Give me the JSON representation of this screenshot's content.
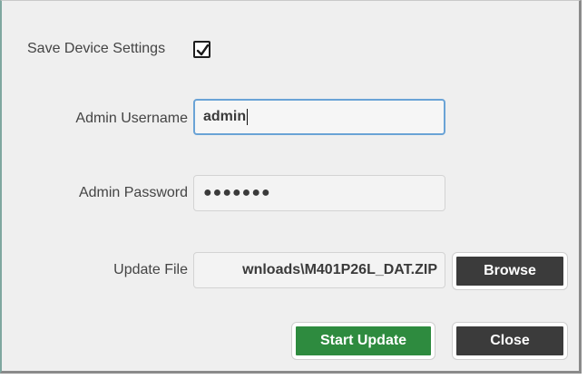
{
  "settings": {
    "save_label": "Save Device Settings",
    "save_checked": true
  },
  "username": {
    "label": "Admin Username",
    "value": "admin"
  },
  "password": {
    "label": "Admin Password",
    "value": "●●●●●●●"
  },
  "update_file": {
    "label": "Update File",
    "value": "wnloads\\M401P26L_DAT.ZIP"
  },
  "buttons": {
    "browse": "Browse",
    "start_update": "Start Update",
    "close": "Close"
  },
  "colors": {
    "start_button": "#2e8b3f",
    "dark_button": "#3b3b3b",
    "focus_border": "#6aa3d6"
  },
  "icons": {
    "checkbox": "checkmark-icon"
  }
}
